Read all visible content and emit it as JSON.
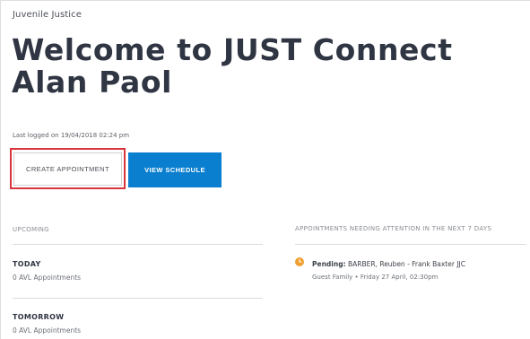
{
  "breadcrumb": "Juvenile Justice",
  "title": {
    "line1": "Welcome to JUST Connect",
    "line2": "Alan Paol"
  },
  "last_logged": "Last logged on 19/04/2018 02:24 pm",
  "buttons": {
    "create": "CREATE APPOINTMENT",
    "schedule": "VIEW SCHEDULE"
  },
  "upcoming": {
    "heading": "UPCOMING",
    "today": {
      "label": "TODAY",
      "count": "0 AVL Appointments"
    },
    "tomorrow": {
      "label": "TOMORROW",
      "count": "0 AVL Appointments"
    }
  },
  "attention": {
    "heading": "APPOINTMENTS NEEDING ATTENTION IN THE NEXT 7 DAYS",
    "items": [
      {
        "status": "Pending:",
        "detail": "BARBER, Reuben - Frank Baxter JJC",
        "sub": "Guest Family  • Friday 27 April, 02:30pm",
        "icon": "clock-icon"
      }
    ]
  },
  "colors": {
    "accent": "#0a7fcf",
    "focus_ring": "#d8343b",
    "pending_icon": "#f0a030",
    "title": "#2f3542"
  }
}
